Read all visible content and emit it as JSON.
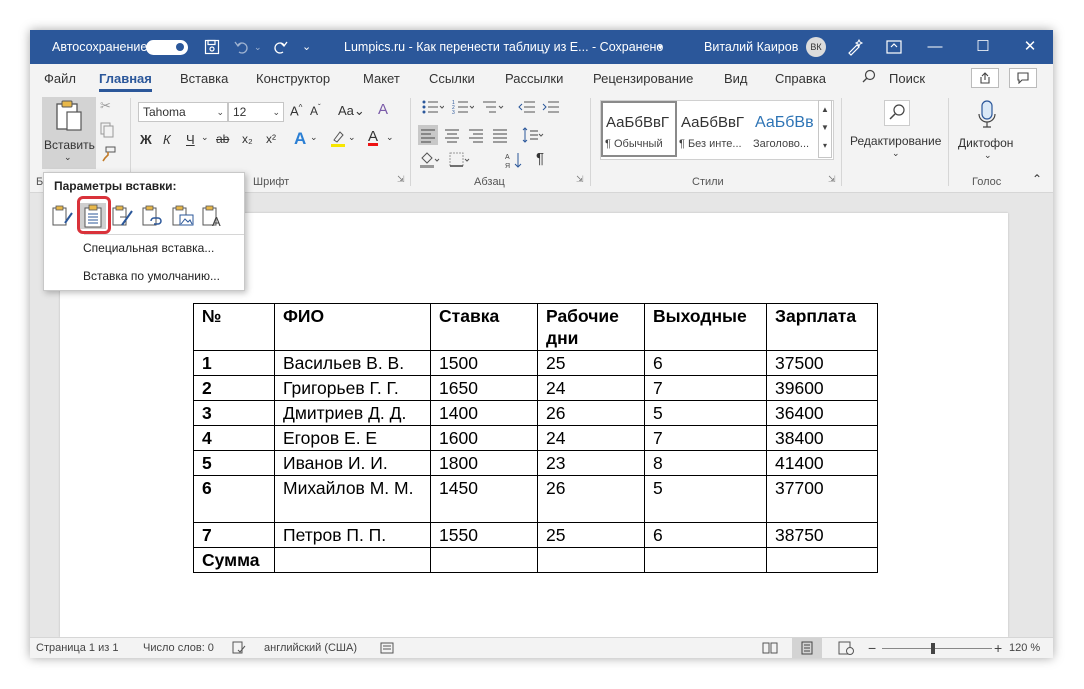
{
  "titlebar": {
    "autosave_label": "Автосохранение",
    "doc_title": "Lumpics.ru - Как перенести таблицу из Е...  -  Сохранено",
    "user_name": "Виталий Каиров",
    "avatar_initials": "ВК"
  },
  "tabs": [
    "Файл",
    "Главная",
    "Вставка",
    "Конструктор",
    "Макет",
    "Ссылки",
    "Рассылки",
    "Рецензирование",
    "Вид",
    "Справка"
  ],
  "search_label": "Поиск",
  "ribbon": {
    "paste_label": "Вставить",
    "font_name": "Tahoma",
    "font_size": "12",
    "font_group_label": "Шрифт",
    "paragraph_group_label": "Абзац",
    "styles_group_label": "Стили",
    "voice_group_label": "Голос",
    "clipboard_group_label": "Б",
    "format_buttons": {
      "bold": "Ж",
      "italic": "К",
      "underline": "Ч",
      "strike": "ab",
      "sub": "x₂",
      "sup": "x²"
    },
    "styles": [
      {
        "preview": "АаБбВвГ",
        "name": "¶ Обычный"
      },
      {
        "preview": "АаБбВвГ",
        "name": "¶ Без инте..."
      },
      {
        "preview": "АаБбВв",
        "name": "Заголово..."
      }
    ],
    "editing_label": "Редактирование",
    "dictate_label": "Диктофон"
  },
  "paste_popup": {
    "title": "Параметры вставки:",
    "special_paste": "Специальная вставка...",
    "default_paste": "Вставка по умолчанию..."
  },
  "table": {
    "headers": [
      "№",
      "ФИО",
      "Ставка",
      "Рабочие дни",
      "Выходные",
      "Зарплата"
    ],
    "rows": [
      [
        "1",
        "Васильев В. В.",
        "1500",
        "25",
        "6",
        "37500"
      ],
      [
        "2",
        "Григорьев Г. Г.",
        "1650",
        "24",
        "7",
        "39600"
      ],
      [
        "3",
        "Дмитриев Д. Д.",
        "1400",
        "26",
        "5",
        "36400"
      ],
      [
        "4",
        "Егоров Е. Е",
        "1600",
        "24",
        "7",
        "38400"
      ],
      [
        "5",
        "Иванов И. И.",
        "1800",
        "23",
        "8",
        "41400"
      ],
      [
        "6",
        "Михайлов М. М.",
        "1450",
        "26",
        "5",
        "37700"
      ],
      [
        "7",
        "Петров П. П.",
        "1550",
        "25",
        "6",
        "38750"
      ]
    ],
    "total_label": "Сумма"
  },
  "statusbar": {
    "page": "Страница 1 из 1",
    "words": "Число слов: 0",
    "language": "английский (США)",
    "zoom": "120 %"
  },
  "colors": {
    "accent": "#2b579a",
    "highlight": "#d9323a"
  }
}
